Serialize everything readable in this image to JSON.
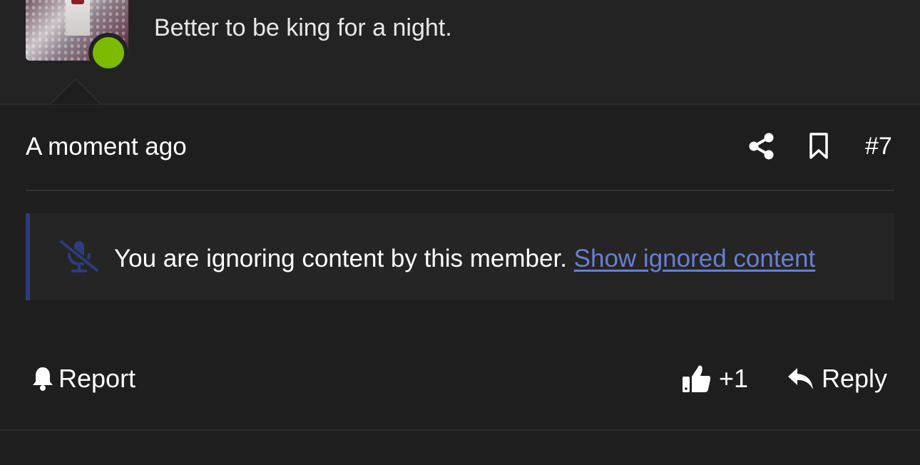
{
  "user": {
    "quote": "Better to be king for a night.",
    "status": "online",
    "status_color": "#7dbb00"
  },
  "post": {
    "timestamp": "A moment ago",
    "number": "#7",
    "icons": {
      "share": "share-icon",
      "bookmark": "bookmark-icon"
    }
  },
  "ignored_notice": {
    "icon": "microphone-slash-icon",
    "text": "You are ignoring content by this member.",
    "link_text": "Show ignored content",
    "accent_color": "#2d3d7a",
    "link_color": "#6a7fd0"
  },
  "actions": {
    "report_label": "Report",
    "like_count": "+1",
    "reply_label": "Reply"
  },
  "colors": {
    "background": "#1e1e1e",
    "panel": "#232323",
    "text": "#ffffff"
  }
}
